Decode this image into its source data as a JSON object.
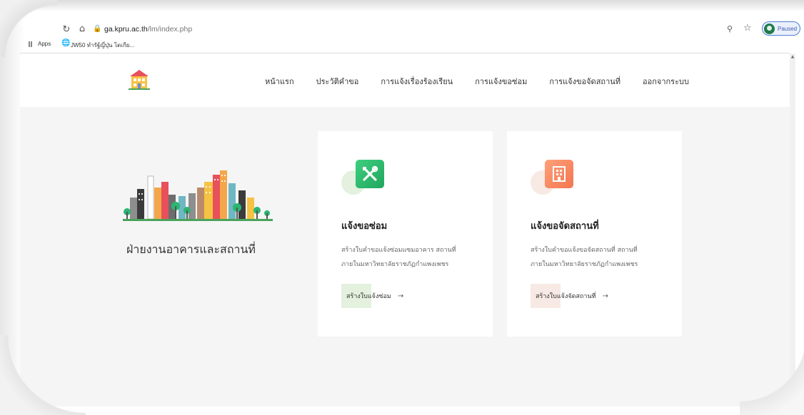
{
  "browser": {
    "url_host": "ga.kpru.ac.th",
    "url_path": "/lm/index.php",
    "profile_status": "Paused",
    "bookmarks": [
      {
        "label": "Apps"
      },
      {
        "label": "JW50 ทำรัฐ์ญี่ปุ่น โตเกีย..."
      }
    ]
  },
  "nav": {
    "items": [
      {
        "label": "หน้าแรก"
      },
      {
        "label": "ประวัติคำขอ"
      },
      {
        "label": "การแจ้งเรื่องร้องเรียน"
      },
      {
        "label": "การแจ้งขอซ่อม"
      },
      {
        "label": "การแจ้งขอจัดสถานที่"
      },
      {
        "label": "ออกจากระบบ"
      }
    ]
  },
  "hero": {
    "title": "ฝ่ายงานอาคารและสถานที่"
  },
  "cards": [
    {
      "title": "แจ้งขอซ่อม",
      "desc_line1": "สร้างใบคำขอแจ้งซ่อมแซมอาคาร สถานที่",
      "desc_line2": "ภายในมหาวิทยาลัยราชภัฏกำแพงเพชร",
      "button": "สร้างใบแจ้งซ่อม",
      "icon": "tools-icon",
      "accent": "#2bb673",
      "accent_soft": "#e3f1de"
    },
    {
      "title": "แจ้งขอจัดสถานที่",
      "desc_line1": "สร้างใบคำขอแจ้งขอจัดสถานที่ สถานที่",
      "desc_line2": "ภายในมหาวิทยาลัยราชภัฏกำแพงเพชร",
      "button": "สร้างใบแจ้งจัดสถานที่",
      "icon": "building-icon",
      "accent": "#f4845f",
      "accent_soft": "#f7e9e3"
    }
  ]
}
